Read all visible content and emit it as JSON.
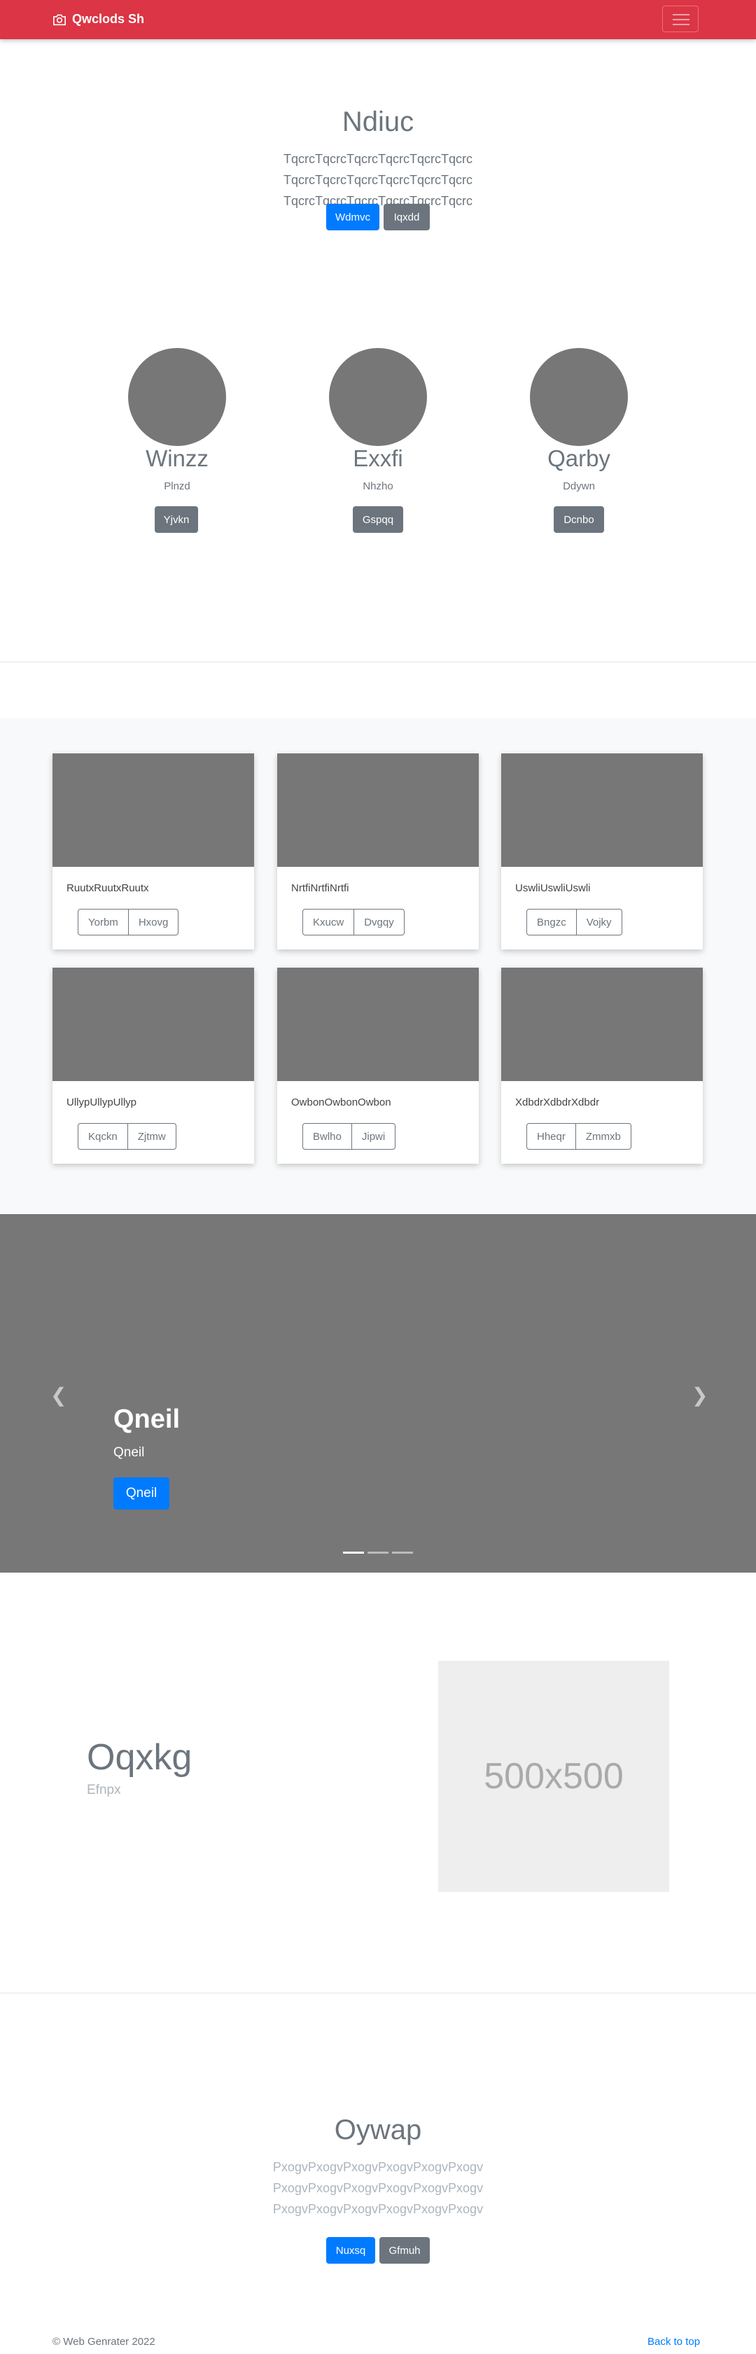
{
  "navbar": {
    "brand": "Qwclods Sh",
    "brand_icon": "camera-icon",
    "toggler_icon": "hamburger-icon"
  },
  "hero": {
    "title": "Ndiuc",
    "lead": "TqcrcTqcrcTqcrcTqcrcTqcrcTqcrc TqcrcTqcrcTqcrcTqcrcTqcrcTqcrc TqcrcTqcrcTqcrcTqcrcTqcrcTqcrc",
    "primary_button": "Wdmvc",
    "secondary_button": "Iqxdd"
  },
  "team": [
    {
      "name": "Winzz",
      "role": "Plnzd",
      "button": "Yjvkn"
    },
    {
      "name": "Exxfi",
      "role": "Nhzho",
      "button": "Gspqq"
    },
    {
      "name": "Qarby",
      "role": "Ddywn",
      "button": "Dcnbo"
    }
  ],
  "album": [
    {
      "text": "RuutxRuutxRuutx",
      "btn1": "Yorbm",
      "btn2": "Hxovg"
    },
    {
      "text": "NrtfiNrtfiNrtfi",
      "btn1": "Kxucw",
      "btn2": "Dvgqy"
    },
    {
      "text": "UswliUswliUswli",
      "btn1": "Bngzc",
      "btn2": "Vojky"
    },
    {
      "text": "UllypUllypUllyp",
      "btn1": "Kqckn",
      "btn2": "Zjtmw"
    },
    {
      "text": "OwbonOwbonOwbon",
      "btn1": "Bwlho",
      "btn2": "Jipwi"
    },
    {
      "text": "XdbdrXdbdrXdbdr",
      "btn1": "Hheqr",
      "btn2": "Zmmxb"
    }
  ],
  "carousel": {
    "title": "Qneil",
    "subtitle": "Qneil",
    "button": "Qneil",
    "slide_count": 3,
    "active_slide": 1,
    "prev_icon": "chevron-left-icon",
    "next_icon": "chevron-right-icon"
  },
  "feature": {
    "title": "Oqxkg",
    "subtitle": "Efnpx",
    "image_label": "500x500"
  },
  "section": {
    "title": "Oywap",
    "lead": "PxogvPxogvPxogvPxogvPxogvPxogv PxogvPxogvPxogvPxogvPxogvPxogv PxogvPxogvPxogvPxogvPxogvPxogv",
    "primary_button": "Nuxsq",
    "secondary_button": "Gfmuh"
  },
  "footer": {
    "copyright": "© Web Genrater 2022",
    "back_to_top": "Back to top"
  },
  "colors": {
    "navbar": "#dc3545",
    "primary": "#007bff",
    "secondary": "#6c757d",
    "placeholder": "#777777"
  }
}
